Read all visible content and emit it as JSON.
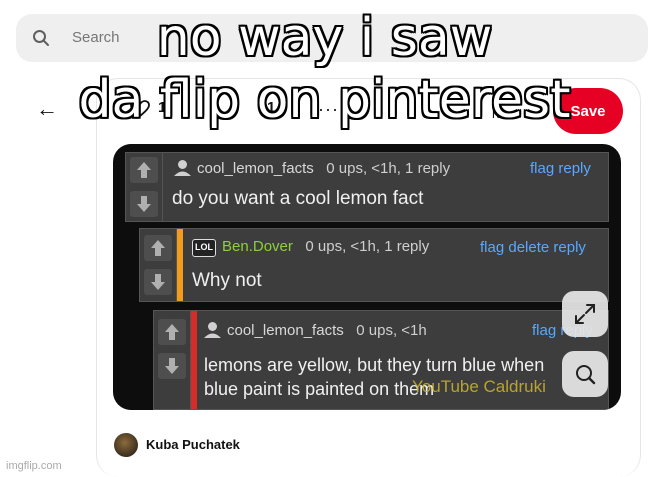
{
  "search": {
    "placeholder": "Search"
  },
  "pin_header": {
    "back_symbol": "←",
    "pin_count": "1",
    "more_count": "1",
    "more_symbol": "···",
    "board_fragment": "ra",
    "save_label": "Save"
  },
  "pin_image": {
    "comments": [
      {
        "username": "cool_lemon_facts",
        "meta": "0 ups, <1h, 1 reply",
        "actions": "flag reply",
        "text": "do you want a cool lemon fact"
      },
      {
        "badge": "LOL",
        "username": "Ben.Dover",
        "meta": "0 ups, <1h, 1 reply",
        "actions": "flag delete reply",
        "text": "Why not"
      },
      {
        "username": "cool_lemon_facts",
        "meta": "0 ups, <1h",
        "actions": "flag reply",
        "text_line1": "lemons are yellow, but they turn blue when",
        "text_line2": "blue paint is painted on them"
      }
    ],
    "watermark": "YouTube Caldruki"
  },
  "author": {
    "name": "Kuba Puchatek"
  },
  "meme_caption": {
    "line1": "no way i saw",
    "line2": "da flip on pinterest"
  },
  "site_watermark": "imgflip.com",
  "colors": {
    "save": "#e60023",
    "stripe_orange": "#f29b1d",
    "stripe_red": "#d92a2a",
    "link_blue": "#58a8ff",
    "username_green": "#8ecf3f"
  }
}
